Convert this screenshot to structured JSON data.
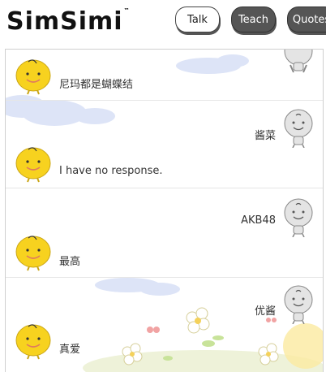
{
  "header": {
    "logo_text": "SimSimi",
    "logo_tm": "™",
    "tabs": [
      {
        "label": "Talk",
        "active": true
      },
      {
        "label": "Teach",
        "active": false
      },
      {
        "label": "Quotes",
        "active": false
      }
    ]
  },
  "conversation": [
    {
      "speaker": "simsimi",
      "text": "尼玛都是蝴蝶结"
    },
    {
      "speaker": "user",
      "text": "酱菜"
    },
    {
      "speaker": "simsimi",
      "text": "I have no response."
    },
    {
      "speaker": "user",
      "text": "AKB48"
    },
    {
      "speaker": "simsimi",
      "text": "最高"
    },
    {
      "speaker": "user",
      "text": "优酱"
    },
    {
      "speaker": "simsimi",
      "text": "真爱"
    }
  ],
  "colors": {
    "bot_face": "#f7d21f",
    "tab_dark": "#555555",
    "cloud": "#dbe3f7"
  }
}
